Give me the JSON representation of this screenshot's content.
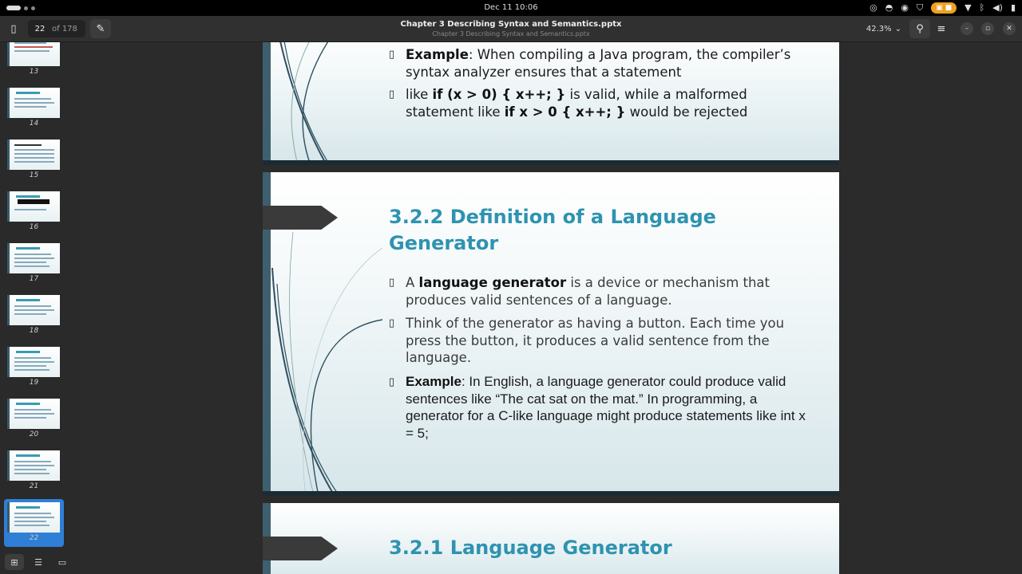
{
  "system": {
    "clock": "Dec 11  10:06"
  },
  "header": {
    "page_current": "22",
    "page_total": "of 178",
    "title": "Chapter 3 Describing Syntax and Semantics.pptx",
    "subtitle": "Chapter 3 Describing Syntax and Semantics.pptx",
    "zoom": "42.3%"
  },
  "sidebar": {
    "thumbnails": [
      {
        "num": "13"
      },
      {
        "num": "14"
      },
      {
        "num": "15"
      },
      {
        "num": "16"
      },
      {
        "num": "17"
      },
      {
        "num": "18"
      },
      {
        "num": "19"
      },
      {
        "num": "20"
      },
      {
        "num": "21"
      },
      {
        "num": "22"
      }
    ]
  },
  "slides": {
    "prev": {
      "b1_label": "Example",
      "b1_text": ": When compiling a Java program, the compiler’s syntax analyzer ensures that a statement",
      "b2_pre": "like ",
      "b2_code1": "if (x > 0) { x++; }",
      "b2_mid": " is valid, while a malformed statement like ",
      "b2_code2": "if x > 0 { x++; }",
      "b2_post": " would be rejected"
    },
    "current": {
      "title": "3.2.2 Definition of a Language Generator",
      "b1_pre": "A ",
      "b1_bold": "language generator",
      "b1_post": " is a device or mechanism that produces valid sentences of a language.",
      "b2_text": "Think of the generator as having a button. Each time you press the button, it produces a valid sentence from the language.",
      "b3_label": "Example",
      "b3_text": ": In English, a language generator could produce valid sentences like “The cat sat on the mat.” In programming, a generator for a C-like language might produce statements like int x = 5;"
    },
    "next": {
      "title": "3.2.1 Language Generator"
    }
  }
}
